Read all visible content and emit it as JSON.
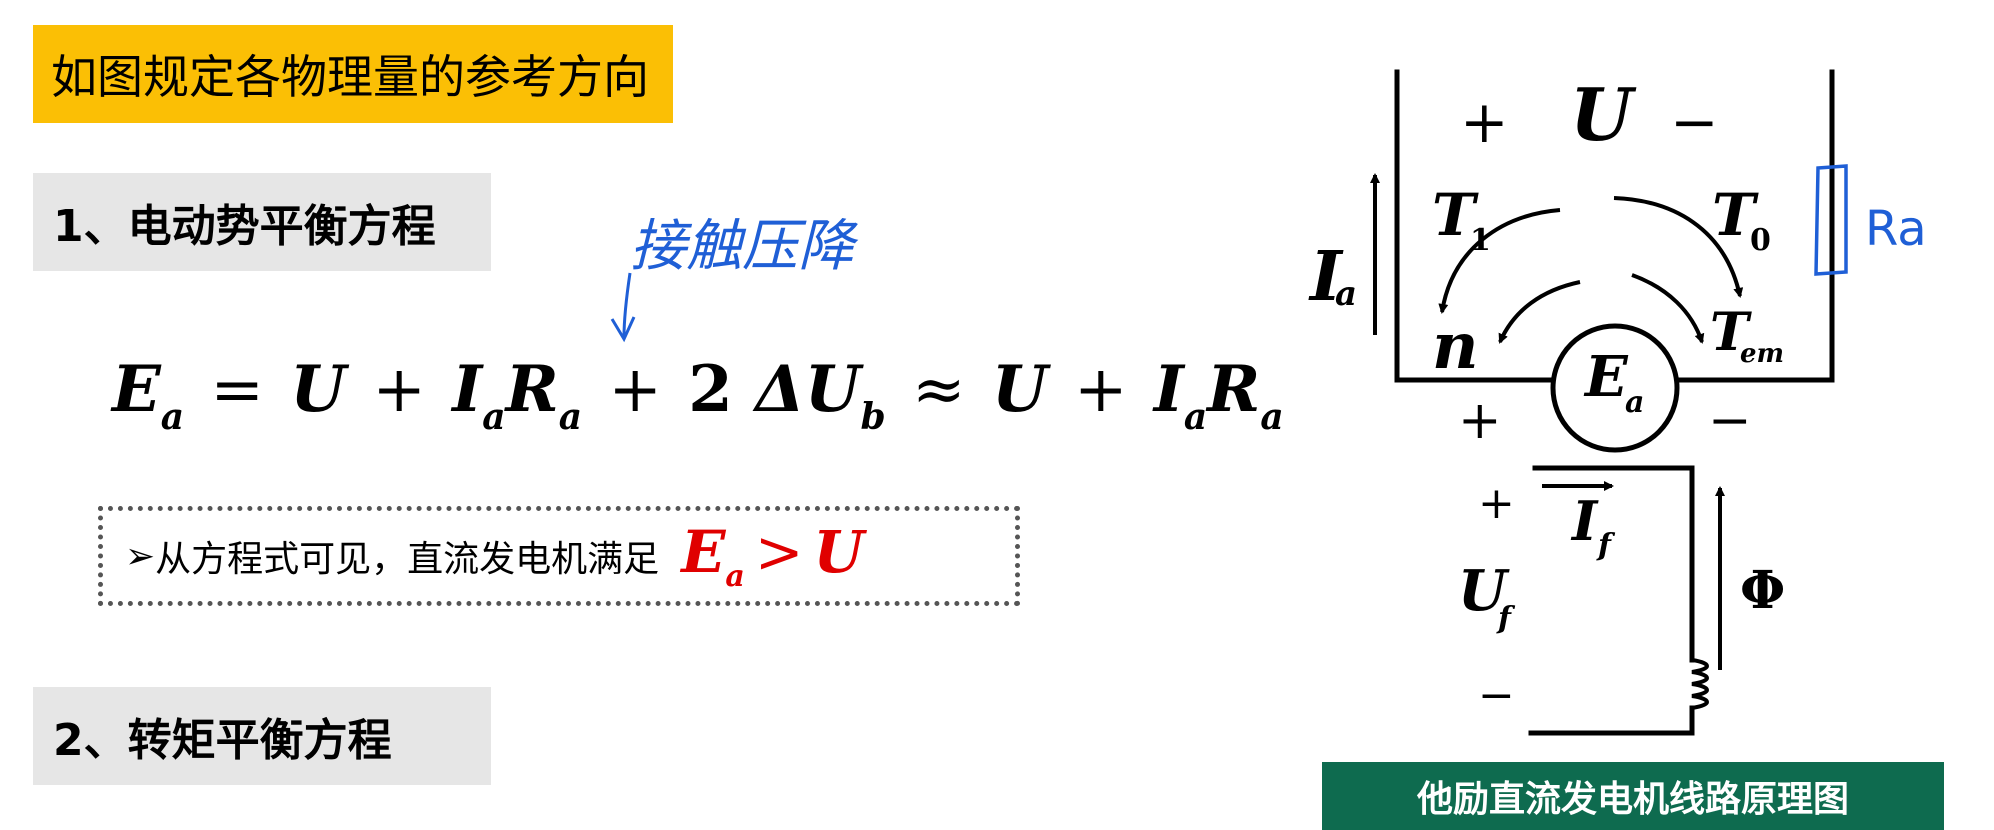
{
  "banner": {
    "text": "如图规定各物理量的参考方向"
  },
  "section1": {
    "title": "1、电动势平衡方程"
  },
  "section2": {
    "title": "2、转矩平衡方程"
  },
  "annotation": {
    "handwritten": "接触压降"
  },
  "equation": {
    "Ea": "E",
    "Ea_sub": "a",
    "eq": "=",
    "U1": "U",
    "plus1": "+",
    "Ia1": "I",
    "Ia1_sub": "a",
    "Ra1": "R",
    "Ra1_sub": "a",
    "plus2": "+",
    "two": "2",
    "delta": "ΔU",
    "delta_sub": "b",
    "approx": "≈",
    "U2": "U",
    "plus3": "+",
    "Ia2": "I",
    "Ia2_sub": "a",
    "Ra2": "R",
    "Ra2_sub": "a"
  },
  "note": {
    "arrow": "➢",
    "text": "从方程式可见，直流发电机满足",
    "E": "E",
    "E_sub": "a",
    "gt": ">",
    "U": "U"
  },
  "diagram": {
    "U_plus": "+",
    "U_label": "U",
    "U_minus": "−",
    "T1": "T",
    "T1_sub": "1",
    "T0": "T",
    "T0_sub": "0",
    "Ia": "I",
    "Ia_sub": "a",
    "n": "n",
    "Tem": "T",
    "Tem_sub": "em",
    "Ea": "E",
    "Ea_sub": "a",
    "plus_a": "+",
    "minus_a": "−",
    "uf_plus": "+",
    "If": "I",
    "If_sub": "f",
    "Uf": "U",
    "Uf_sub": "f",
    "uf_minus": "−",
    "Phi": "Φ",
    "Ra_handwritten": "Ra"
  },
  "caption": {
    "text": "他励直流发电机线路原理图"
  },
  "colors": {
    "banner": "#fbbf05",
    "section": "#e6e6e6",
    "caption": "#0e6b4f",
    "highlight": "#e00000",
    "ink_blue": "#1f5fd6"
  }
}
